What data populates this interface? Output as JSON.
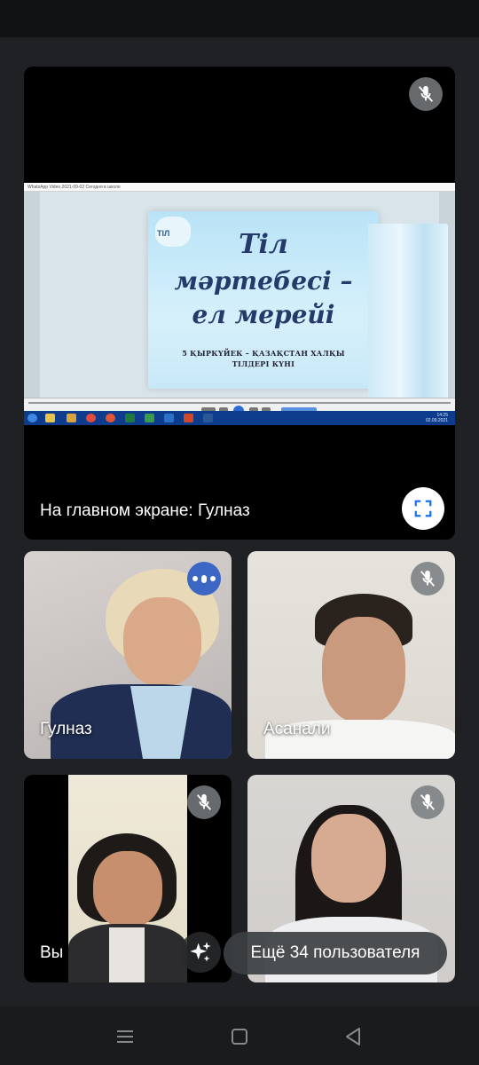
{
  "main_tile": {
    "label": "На главном экране: Гулназ",
    "shared_window_title": "WhatsApp Video 2021-09-02 Сегодня в школе",
    "slide": {
      "logo_text": "ТІЛ",
      "line1": "Тіл",
      "line2": "мәртебесі –",
      "line3": "ел мерейі",
      "sub1": "5 ҚЫРКҮЙЕК – ҚАЗАҚСТАН ХАЛҚЫ",
      "sub2": "ТІЛДЕРІ КҮНІ"
    },
    "taskbar_time": "14:25",
    "taskbar_date": "02.09.2021"
  },
  "participants": [
    {
      "name": "Гулназ",
      "state": "speaking"
    },
    {
      "name": "Асанали",
      "state": "muted"
    },
    {
      "name": "Вы",
      "state": "muted"
    },
    {
      "name": "",
      "state": "muted"
    }
  ],
  "more_users_label": "Ещё 34 пользователя",
  "icons": {
    "mute": "mic-off-icon",
    "speaking": "speaking-indicator-icon",
    "fullscreen": "fullscreen-icon",
    "effects": "sparkle-effects-icon"
  },
  "colors": {
    "background": "#202124",
    "speaking_accent": "#3b66c4",
    "fullscreen_icon": "#1a73e8"
  }
}
